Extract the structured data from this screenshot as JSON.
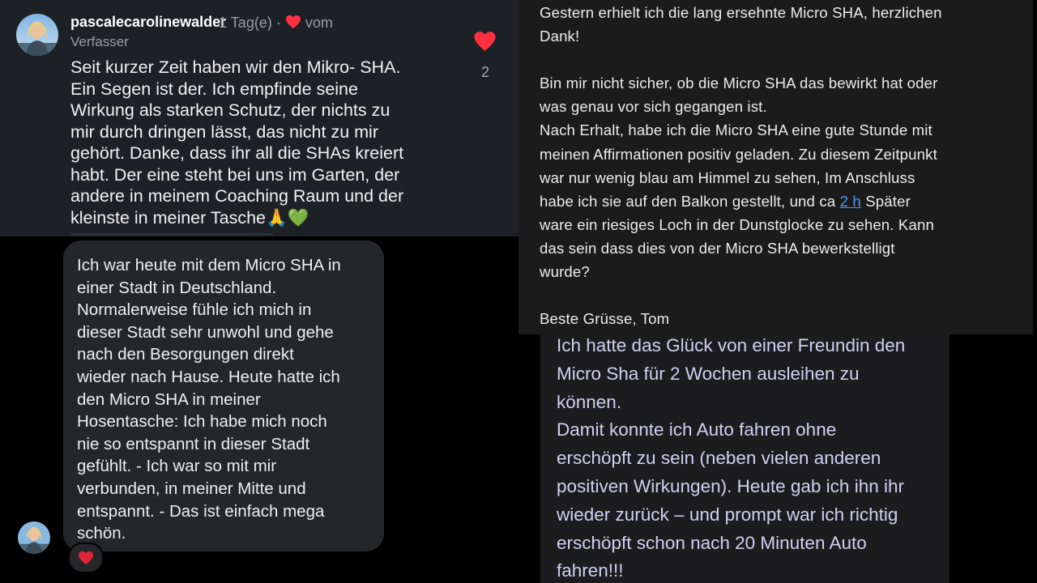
{
  "comment": {
    "username": "pascalecarolinewalder",
    "time": "1 Tag(e)",
    "separator": "·",
    "liked_by": "vom",
    "author_tag": "Verfasser",
    "text": "Seit kurzer Zeit haben wir den Mikro- SHA.\nEin Segen ist der. Ich empfinde seine\nWirkung als starken Schutz, der nichts zu\nmir durch dringen lässt, das nicht zu mir\ngehört. Danke, dass ihr all die SHAs kreiert\nhabt. Der eine steht bei uns im Garten, der\nandere in meinem Coaching Raum und der\nkleinste in meiner Tasche",
    "emoji": "🙏💚",
    "like_count": "2",
    "icons": {
      "avatar": "avatar-photo",
      "heart": "heart-icon",
      "like": "heart-like-icon"
    },
    "colors": {
      "heart": "#ff3040"
    }
  },
  "chat": {
    "message": "Ich war heute mit dem Micro SHA in\neiner Stadt in Deutschland.\nNormalerweise fühle ich mich in\ndieser Stadt sehr unwohl und gehe\nnach den Besorgungen direkt\nwieder nach Hause. Heute hatte ich\nden Micro SHA in meiner\nHosentasche: Ich habe mich noch\nnie so entspannt in dieser Stadt\ngefühlt. - Ich war so mit mir\nverbunden, in meiner Mitte und\nentspannt. - Das ist einfach mega\nschön.",
    "reaction": "❤️"
  },
  "email": {
    "before_link": "Gestern erhielt ich die lang ersehnte Micro SHA, herzlichen\nDank!\n\nBin mir nicht sicher, ob die Micro SHA das bewirkt hat oder\nwas  genau vor sich gegangen ist.\nNach Erhalt, habe ich die Micro SHA eine gute Stunde mit\nmeinen Affirmationen positiv geladen. Zu diesem Zeitpunkt\nwar nur wenig blau am Himmel zu sehen, Im Anschluss\nhabe ich sie auf den Balkon gestellt, und ca ",
    "link": "2 h",
    "after_link": " Später\nware ein riesiges Loch in der Dunstglocke zu sehen. Kann\ndas sein dass dies von der Micro SHA bewerkstelligt\nwurde?\n\nBeste Grüsse, Tom",
    "colors": {
      "link": "#4b9bf0"
    }
  },
  "testimonial": {
    "text": "Ich hatte das Glück von einer Freundin den\nMicro Sha für 2 Wochen ausleihen zu\nkönnen.\nDamit konnte ich Auto fahren ohne\nerschöpft zu sein (neben vielen anderen\npositiven Wirkungen). Heute gab ich ihn ihr\nwieder zurück – und prompt war ich richtig\nerschöpft schon nach 20 Minuten Auto\nfahren!!!"
  }
}
